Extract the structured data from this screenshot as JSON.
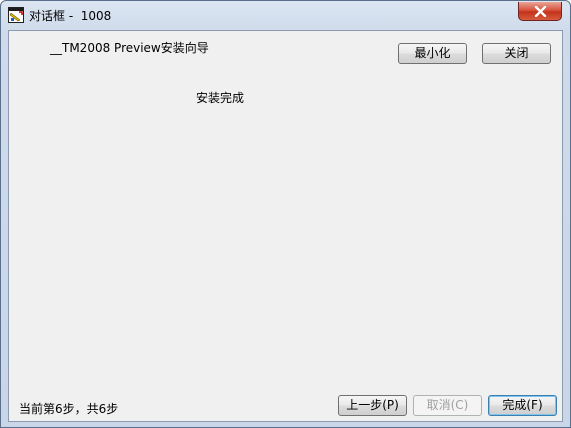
{
  "window": {
    "title": "对话框 -  1008"
  },
  "wizard": {
    "heading": "__TM2008 Preview安装向导",
    "message": "安装完成",
    "step_text": "当前第6步，共6步"
  },
  "buttons": {
    "minimize": "最小化",
    "close": "关闭",
    "back": "上一步(P)",
    "cancel": "取消(C)",
    "finish": "完成(F)"
  },
  "colors": {
    "client_bg": "#f0f0f0",
    "close_red": "#c4321a"
  }
}
